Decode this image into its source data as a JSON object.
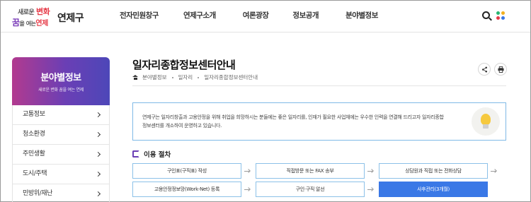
{
  "header": {
    "logo": {
      "slogan_top": "새로운",
      "slogan_top_em": "변화",
      "slogan_bottom_1": "꿈",
      "slogan_bottom_2": "을 여는",
      "slogan_bottom_3": "연제",
      "name": "연제구"
    },
    "nav": [
      "전자민원창구",
      "연제구소개",
      "여론광장",
      "정보공개",
      "분야별정보"
    ],
    "icons": {
      "search": "search-icon",
      "menu": "all-menu-icon"
    },
    "menu_dot_colors": [
      "#2bb673",
      "#f2b01e",
      "#e63946",
      "#3a78e6"
    ]
  },
  "sidebar": {
    "title": "분야별정보",
    "subtitle": "새로운 변화 꿈을 여는 연제",
    "items": [
      "교통정보",
      "청소환경",
      "주민생활",
      "도시/주택",
      "민방위/재난"
    ]
  },
  "page": {
    "title": "일자리종합정보센터안내",
    "breadcrumb": [
      "분야별정보",
      "일자리",
      "일자리종합정보센터안내"
    ],
    "intro": "연제구는 일자리창출과 고용안정을 위해 취업을 희망하시는 분들에는 좋은 일자리를, 인재가 필요한 사업체에는 우수한 인력을 연결해 드리고자 일자리종합정보센터를 개소하여 운영하고 있습니다.",
    "procedure_title": "이용 절차",
    "steps_row1": [
      "구인표(구직표) 작성",
      "직접방문 또는 FAX 송부",
      "상담원과 직접 또는 전화상담"
    ],
    "steps_row2": [
      "고용안정정보망(Work-Net) 등록",
      "구인·구직 알선",
      "사후관리(3개월)"
    ]
  },
  "colors": {
    "accent_purple": "#6a3fb5",
    "step_active": "#3a78e6",
    "box_border": "#8cc1e8"
  }
}
